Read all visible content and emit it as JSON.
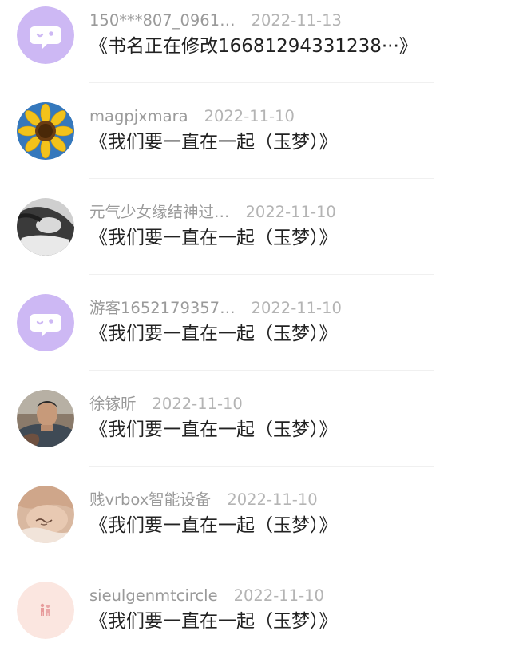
{
  "comments": [
    {
      "user": "150***807_0961…",
      "date": "2022-11-13",
      "text": "《书名正在修改16681294331238···》",
      "avatar": "chat-bubble-icon"
    },
    {
      "user": "magpjxmara",
      "date": "2022-11-10",
      "text": "《我们要一直在一起（玉梦）》",
      "avatar": "sunflower"
    },
    {
      "user": "元气少女缘结神过…",
      "date": "2022-11-10",
      "text": "《我们要一直在一起（玉梦）》",
      "avatar": "person-lying-photo"
    },
    {
      "user": "游客1652179357…",
      "date": "2022-11-10",
      "text": "《我们要一直在一起（玉梦）》",
      "avatar": "chat-bubble-icon"
    },
    {
      "user": "徐镓昕",
      "date": "2022-11-10",
      "text": "《我们要一直在一起（玉梦）》",
      "avatar": "man-photo"
    },
    {
      "user": "贱vrbox智能设备",
      "date": "2022-11-10",
      "text": "《我们要一直在一起（玉梦）》",
      "avatar": "tattoo-photo"
    },
    {
      "user": "sieulgenmtcircle",
      "date": "2022-11-10",
      "text": "《我们要一直在一起（玉梦）》",
      "avatar": "pink-figures"
    }
  ],
  "colors": {
    "default_avatar_bg": "#cdb8f4",
    "username": "#9a9a9a",
    "date": "#b4b4b4",
    "text": "#222222"
  }
}
